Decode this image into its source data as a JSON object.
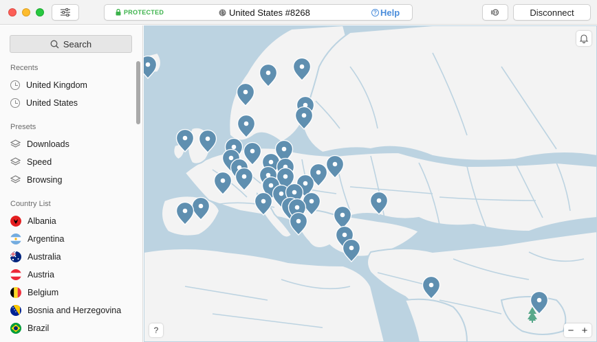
{
  "window": {
    "status": "PROTECTED",
    "server": "United States #8268",
    "help_label": "Help",
    "disconnect_label": "Disconnect"
  },
  "sidebar": {
    "search_label": "Search",
    "recents_label": "Recents",
    "recents": [
      {
        "label": "United Kingdom",
        "icon": "clock-icon"
      },
      {
        "label": "United States",
        "icon": "clock-icon"
      }
    ],
    "presets_label": "Presets",
    "presets": [
      {
        "label": "Downloads",
        "icon": "layers-icon"
      },
      {
        "label": "Speed",
        "icon": "layers-icon"
      },
      {
        "label": "Browsing",
        "icon": "layers-icon"
      }
    ],
    "countries_label": "Country List",
    "countries": [
      {
        "label": "Albania",
        "icon": "flag-albania-icon"
      },
      {
        "label": "Argentina",
        "icon": "flag-argentina-icon"
      },
      {
        "label": "Australia",
        "icon": "flag-australia-icon"
      },
      {
        "label": "Austria",
        "icon": "flag-austria-icon"
      },
      {
        "label": "Belgium",
        "icon": "flag-belgium-icon"
      },
      {
        "label": "Bosnia and Herzegovina",
        "icon": "flag-bosnia-icon"
      },
      {
        "label": "Brazil",
        "icon": "flag-brazil-icon"
      }
    ]
  },
  "map": {
    "help_label": "?",
    "zoom_out_label": "−",
    "zoom_in_label": "+"
  },
  "colors": {
    "water": "#bcd3e1",
    "land": "#f3f3f3",
    "pin": "#5f8fb0",
    "protected": "#3bb24a",
    "help": "#4a8ddb"
  }
}
